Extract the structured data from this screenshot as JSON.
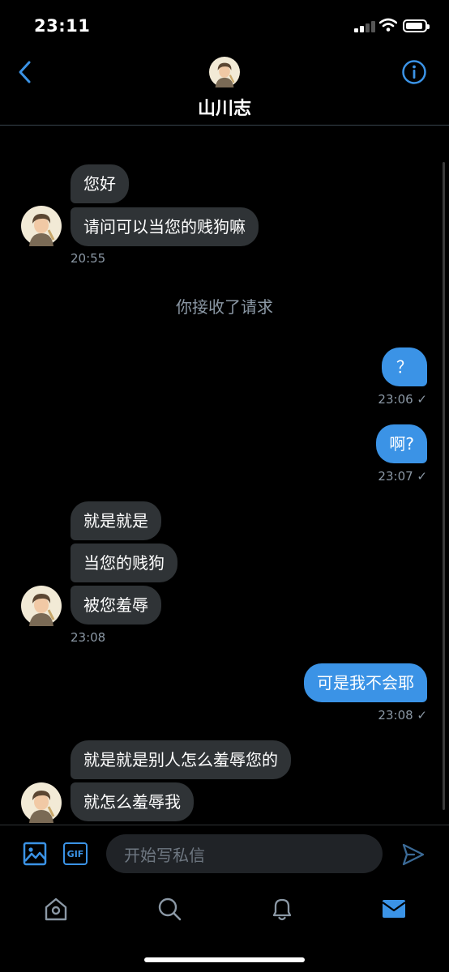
{
  "status": {
    "time": "23:11"
  },
  "header": {
    "title": "山川志"
  },
  "messages": {
    "in1_a": "您好",
    "in1_b": "请问可以当您的贱狗嘛",
    "in1_time": "20:55",
    "system_note": "你接收了请求",
    "out1": "？",
    "out1_time": "23:06 ✓",
    "out2": "啊?",
    "out2_time": "23:07 ✓",
    "in2_a": "就是就是",
    "in2_b": "当您的贱狗",
    "in2_c": "被您羞辱",
    "in2_time": "23:08",
    "out3": "可是我不会耶",
    "out3_time": "23:08 ✓",
    "in3_a": "就是就是别人怎么羞辱您的",
    "in3_b": "就怎么羞辱我"
  },
  "composer": {
    "placeholder": "开始写私信",
    "gif_label": "GIF"
  },
  "icons": {
    "back": "chevron-left-icon",
    "info": "info-icon",
    "image": "image-icon",
    "gif": "gif-icon",
    "send": "send-icon",
    "tabs": [
      "home-icon",
      "search-icon",
      "bell-icon",
      "mail-icon"
    ]
  },
  "colors": {
    "accent": "#3b93e6",
    "incoming_bubble": "#2f3336",
    "background": "#000000"
  }
}
